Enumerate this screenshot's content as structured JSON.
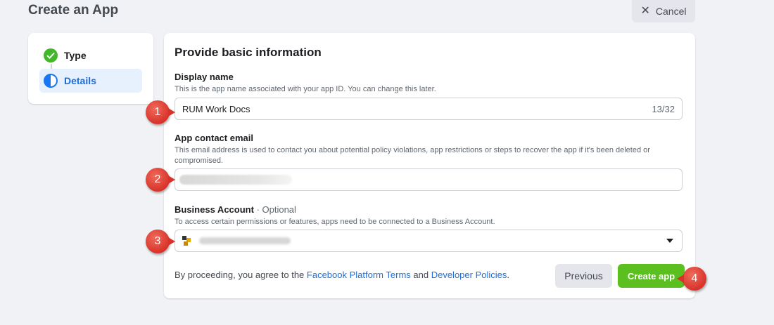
{
  "header": {
    "title": "Create an App",
    "cancel_label": "Cancel"
  },
  "steps": [
    {
      "label": "Type",
      "state": "done"
    },
    {
      "label": "Details",
      "state": "current"
    }
  ],
  "form": {
    "title": "Provide basic information",
    "display_name": {
      "label": "Display name",
      "help": "This is the app name associated with your app ID. You can change this later.",
      "value": "RUM Work Docs",
      "counter": "13/32"
    },
    "contact_email": {
      "label": "App contact email",
      "help": "This email address is used to contact you about potential policy violations, app restrictions or steps to recover the app if it's been deleted or compromised."
    },
    "business_account": {
      "label": "Business Account",
      "optional": "· Optional",
      "help": "To access certain permissions or features, apps need to be connected to a Business Account."
    },
    "terms": {
      "prefix": "By proceeding, you agree to the ",
      "link1": "Facebook Platform Terms",
      "middle": " and ",
      "link2": "Developer Policies",
      "suffix": "."
    },
    "previous_label": "Previous",
    "create_label": "Create app"
  },
  "markers": [
    "1",
    "2",
    "3",
    "4"
  ],
  "colors": {
    "accent": "#1877f2",
    "create_button": "#5cbf20",
    "marker": "#d8332a",
    "success": "#42b72a"
  }
}
